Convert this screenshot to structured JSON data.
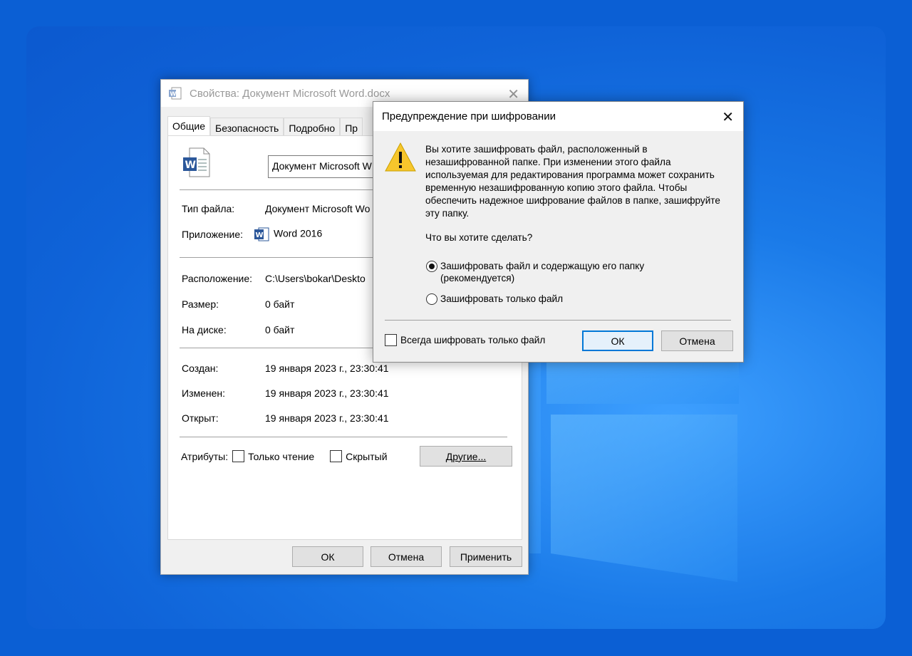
{
  "props_window": {
    "title": "Свойства: Документ Microsoft Word.docx",
    "close_glyph": "✕",
    "tabs": [
      "Общие",
      "Безопасность",
      "Подробно",
      "Пр"
    ],
    "file_name_value": "Документ Microsoft W",
    "rows": {
      "type": {
        "label": "Тип файла:",
        "value": "Документ Microsoft Wo"
      },
      "app": {
        "label": "Приложение:",
        "value": "Word 2016"
      },
      "location": {
        "label": "Расположение:",
        "value": "C:\\Users\\bokar\\Deskto"
      },
      "size": {
        "label": "Размер:",
        "value": "0 байт"
      },
      "ondisk": {
        "label": "На диске:",
        "value": "0 байт"
      },
      "created": {
        "label": "Создан:",
        "value": "19 января 2023 г., 23:30:41"
      },
      "modified": {
        "label": "Изменен:",
        "value": "19 января 2023 г., 23:30:41"
      },
      "opened": {
        "label": "Открыт:",
        "value": "19 января 2023 г., 23:30:41"
      }
    },
    "attributes": {
      "label": "Атрибуты:",
      "readonly": "Только чтение",
      "hidden": "Скрытый",
      "other_button": "Другие..."
    },
    "buttons": {
      "ok": "ОК",
      "cancel": "Отмена",
      "apply": "Применить"
    }
  },
  "warning_dialog": {
    "title": "Предупреждение при шифровании",
    "close_glyph": "✕",
    "message": "Вы хотите зашифровать файл, расположенный в незашифрованной папке. При изменении этого файла используемая для редактирования программа может сохранить временную незашифрованную копию этого файла. Чтобы обеспечить надежное шифрование файлов в папке, зашифруйте эту папку.",
    "question": "Что вы хотите сделать?",
    "option_folder_line1": "Зашифровать файл и содержащую его папку",
    "option_folder_line2": "(рекомендуется)",
    "option_file": "Зашифровать только файл",
    "always_checkbox": "Всегда шифровать только файл",
    "ok": "ОК",
    "cancel": "Отмена",
    "selected_option": "file-and-folder"
  },
  "colors": {
    "desktop": "#0b5fd4",
    "accent": "#0078d7",
    "word_blue": "#2b579a",
    "warning_yellow": "#f7c62c"
  }
}
